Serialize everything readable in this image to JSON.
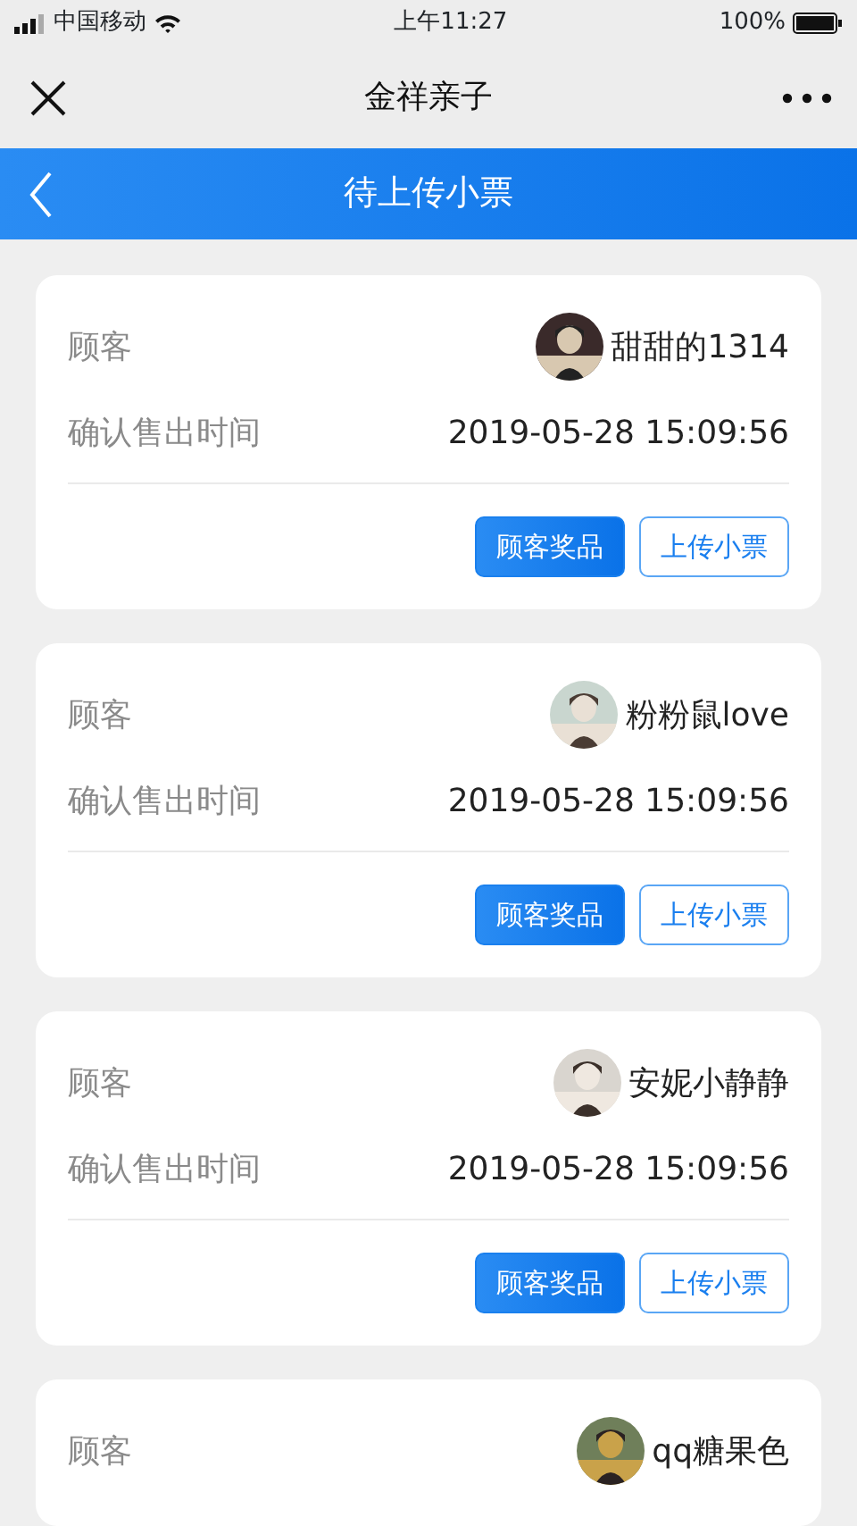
{
  "status_bar": {
    "carrier": "中国移动",
    "time": "上午11:27",
    "battery": "100%"
  },
  "header": {
    "title": "金祥亲子"
  },
  "nav_bar": {
    "title": "待上传小票"
  },
  "cards": [
    {
      "customer_label": "顾客",
      "customer_name": "甜甜的1314",
      "time_label": "确认售出时间",
      "time": "2019-05-28 15:09:56",
      "buttons": [
        {
          "label": "顾客奖品",
          "kind": "primary"
        },
        {
          "label": "上传小票",
          "kind": "outline"
        }
      ]
    },
    {
      "customer_label": "顾客",
      "customer_name": "粉粉鼠love",
      "time_label": "确认售出时间",
      "time": "2019-05-28 15:09:56",
      "buttons": [
        {
          "label": "顾客奖品",
          "kind": "primary"
        },
        {
          "label": "上传小票",
          "kind": "outline"
        }
      ]
    },
    {
      "customer_label": "顾客",
      "customer_name": "安妮小静静",
      "time_label": "确认售出时间",
      "time": "2019-05-28 15:09:56",
      "buttons": [
        {
          "label": "顾客奖品",
          "kind": "primary"
        },
        {
          "label": "上传小票",
          "kind": "outline"
        }
      ]
    },
    {
      "customer_label": "顾客",
      "customer_name": "qq糖果色"
    }
  ]
}
